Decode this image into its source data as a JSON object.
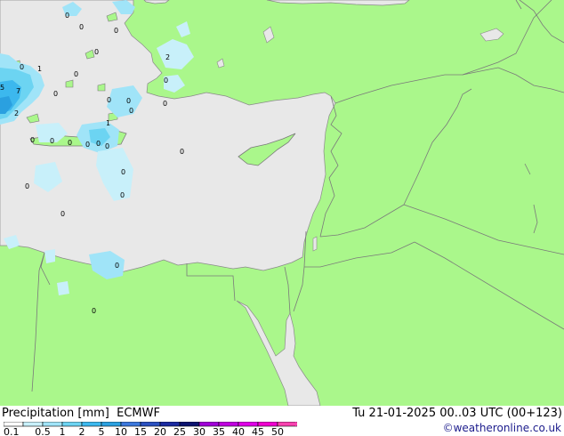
{
  "title": "Precipitation [mm]  ECMWF",
  "datetime": "Tu 21-01-2025 00..03 UTC (00+123)",
  "credit": "©weatheronline.co.uk",
  "colors": {
    "land": "#aaf78b",
    "sea": "#e8e8e8",
    "border": "#7a7a7a"
  },
  "legend": {
    "labels": [
      "0.1",
      "0.5",
      "1",
      "2",
      "5",
      "10",
      "15",
      "20",
      "25",
      "30",
      "35",
      "40",
      "45",
      "50"
    ],
    "colors": [
      "#ffffff",
      "#c8f0fa",
      "#a0e4f8",
      "#6cd4f2",
      "#3cb8ee",
      "#2aa0e0",
      "#3c78dc",
      "#2a50c0",
      "#1a2aa0",
      "#0c1470",
      "#a000d8",
      "#c000e0",
      "#e000e8",
      "#f000d0",
      "#f842b0"
    ]
  },
  "map_labels": [
    {
      "text": "0"
    },
    {
      "text": "0"
    },
    {
      "text": "0"
    },
    {
      "text": "1"
    },
    {
      "text": "0"
    },
    {
      "text": "2"
    },
    {
      "text": "5"
    },
    {
      "text": "7"
    },
    {
      "text": "2"
    },
    {
      "text": "0"
    },
    {
      "text": "0"
    },
    {
      "text": "0"
    },
    {
      "text": "0"
    },
    {
      "text": "0"
    },
    {
      "text": "1"
    },
    {
      "text": "0"
    },
    {
      "text": "0"
    },
    {
      "text": "0"
    },
    {
      "text": "0"
    },
    {
      "text": "0"
    },
    {
      "text": "0"
    },
    {
      "text": "0"
    },
    {
      "text": "0"
    },
    {
      "text": "0"
    },
    {
      "text": "0"
    },
    {
      "text": "0"
    },
    {
      "text": "0"
    },
    {
      "text": "0"
    },
    {
      "text": "0"
    },
    {
      "text": "0"
    },
    {
      "text": "0"
    }
  ]
}
